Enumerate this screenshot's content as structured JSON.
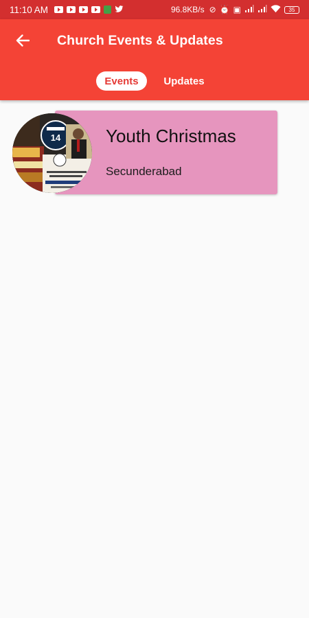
{
  "status_bar": {
    "time": "11:10 AM",
    "network_speed": "96.8KB/s",
    "battery": "35"
  },
  "header": {
    "title": "Church Events & Updates",
    "back_icon": "arrow-left-icon"
  },
  "tabs": [
    {
      "label": "Events",
      "selected": true
    },
    {
      "label": "Updates",
      "selected": false
    }
  ],
  "events": [
    {
      "name": "Youth Christmas",
      "location": "Secunderabad",
      "thumbnail": {
        "date_number": "14"
      }
    }
  ],
  "colors": {
    "status_bar": "#d32f2f",
    "app_bar": "#f44336",
    "card": "#e695be",
    "background": "#fafafa",
    "selected_tab_text": "#e53935"
  }
}
